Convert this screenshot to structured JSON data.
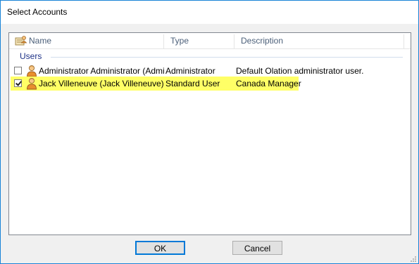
{
  "window": {
    "title": "Select Accounts"
  },
  "list": {
    "columns": [
      {
        "label": "Name"
      },
      {
        "label": "Type"
      },
      {
        "label": "Description"
      }
    ],
    "group_label": "Users",
    "rows": [
      {
        "checked": false,
        "name": "Administrator Administrator (Admini...",
        "type": "Administrator",
        "description": "Default Olation administrator user."
      },
      {
        "checked": true,
        "name": "Jack Villeneuve (Jack Villeneuve)",
        "type": "Standard User",
        "description": "Canada Manager"
      }
    ]
  },
  "buttons": {
    "ok_label": "OK",
    "cancel_label": "Cancel"
  },
  "colors": {
    "highlight": "#ffff66",
    "window_border": "#1883d7",
    "group_label": "#1e3287"
  },
  "icons": {
    "header": "user-list-icon",
    "row": "user-icon"
  }
}
